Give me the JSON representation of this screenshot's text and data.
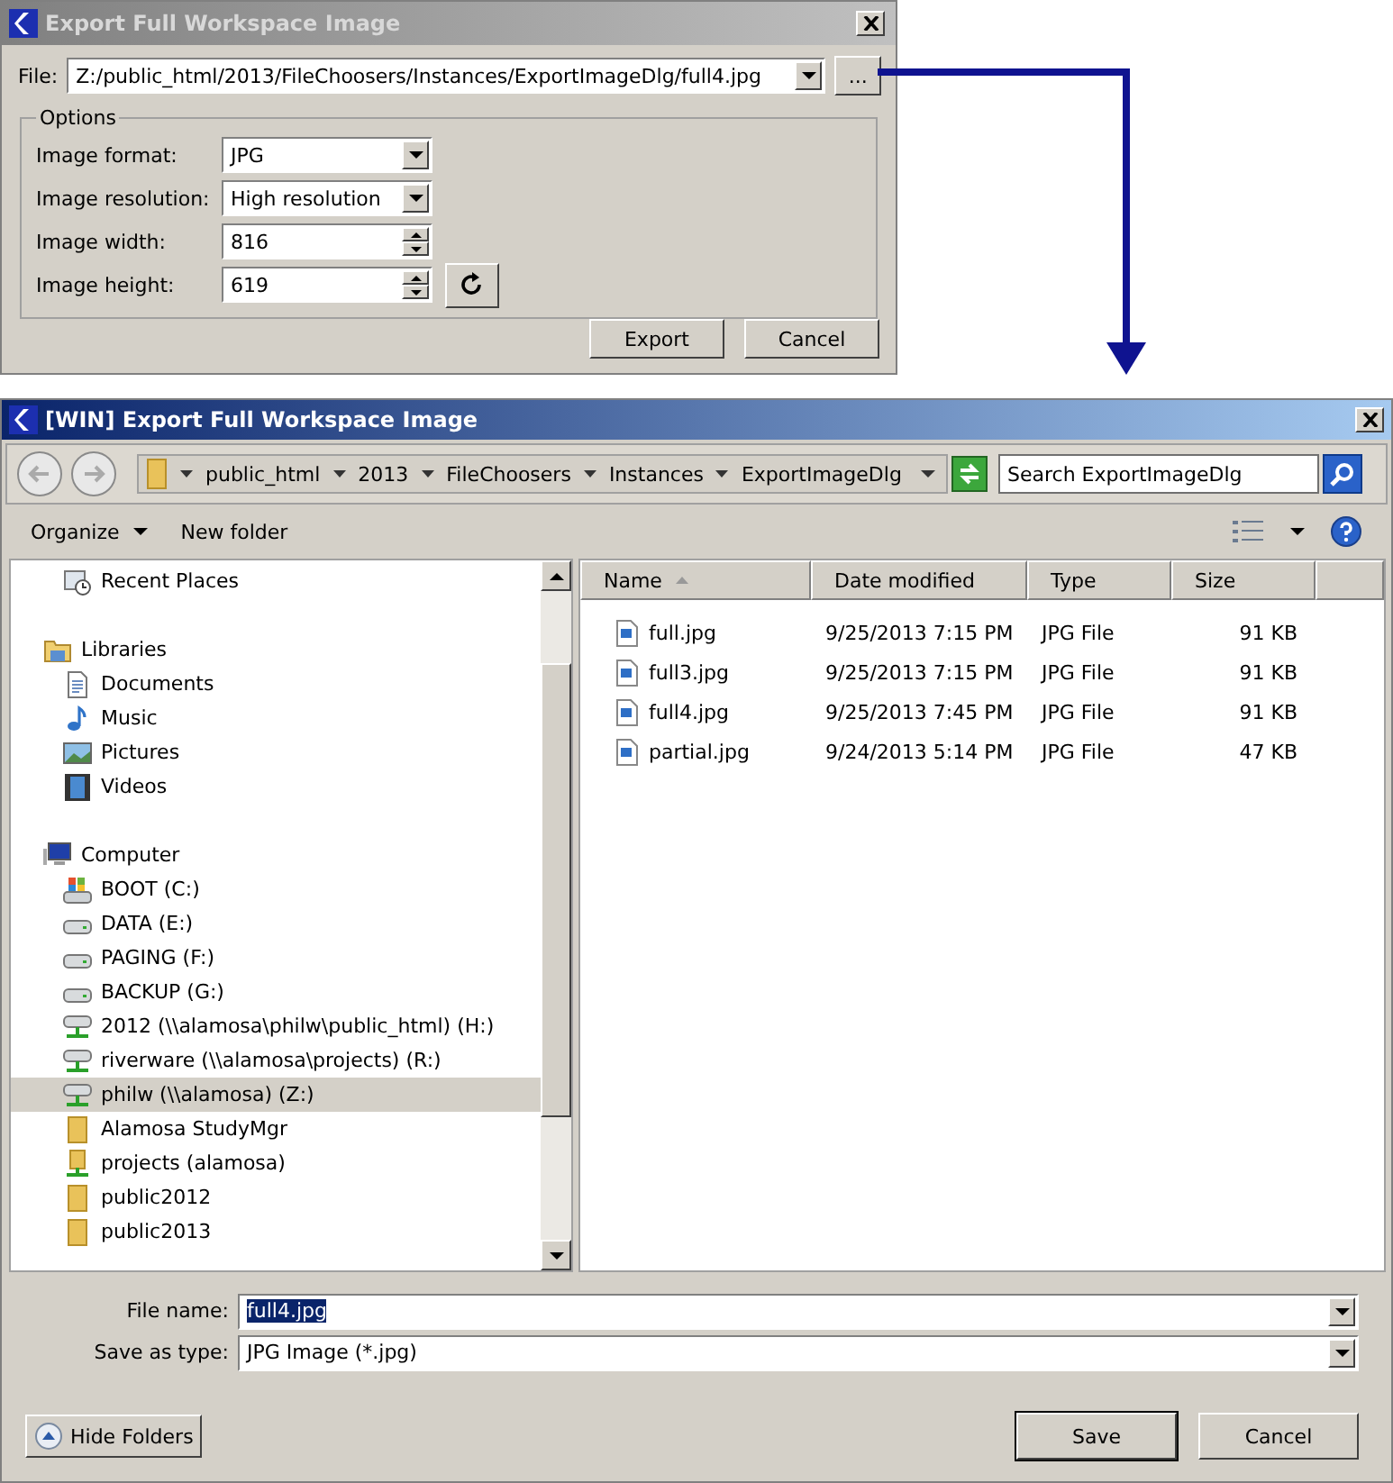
{
  "export_dialog": {
    "title": "Export Full Workspace Image",
    "file_label": "File:",
    "file_value": "Z:/public_html/2013/FileChoosers/Instances/ExportImageDlg/full4.jpg",
    "browse_button": "...",
    "options_title": "Options",
    "options": [
      {
        "kind": "dropdown",
        "label": "Image format:",
        "value": "JPG"
      },
      {
        "kind": "dropdown",
        "label": "Image resolution:",
        "value": "High resolution"
      },
      {
        "kind": "spinner",
        "label": "Image width:",
        "value": "816"
      },
      {
        "kind": "spinner",
        "label": "Image height:",
        "value": "619"
      }
    ],
    "buttons": [
      "Export",
      "Cancel"
    ]
  },
  "file_dialog": {
    "title": "[WIN] Export Full Workspace Image",
    "breadcrumb": [
      "public_html",
      "2013",
      "FileChoosers",
      "Instances",
      "ExportImageDlg"
    ],
    "search": {
      "placeholder": "Search ExportImageDlg"
    },
    "toolbar": [
      "Organize",
      "New folder"
    ],
    "tree_top": [
      {
        "label": "Recent Places",
        "kind": "recent",
        "selected": false
      }
    ],
    "tree": [
      {
        "label": "Libraries",
        "kind": "library",
        "selected": false,
        "children": [
          {
            "label": "Documents",
            "kind": "document",
            "selected": false
          },
          {
            "label": "Music",
            "kind": "music",
            "selected": false
          },
          {
            "label": "Pictures",
            "kind": "pictures",
            "selected": false
          },
          {
            "label": "Videos",
            "kind": "videos",
            "selected": false
          }
        ]
      },
      {
        "label": "Computer",
        "kind": "computer",
        "selected": false,
        "children": [
          {
            "label": "BOOT (C:)",
            "kind": "boot",
            "selected": false
          },
          {
            "label": "DATA (E:)",
            "kind": "drive",
            "selected": false
          },
          {
            "label": "PAGING (F:)",
            "kind": "drive",
            "selected": false
          },
          {
            "label": "BACKUP (G:)",
            "kind": "drive",
            "selected": false
          },
          {
            "label": "2012 (\\\\alamosa\\philw\\public_html) (H:)",
            "kind": "netdrive",
            "selected": false
          },
          {
            "label": "riverware (\\\\alamosa\\projects) (R:)",
            "kind": "netdrive",
            "selected": false
          },
          {
            "label": "philw (\\\\alamosa) (Z:)",
            "kind": "netdrive",
            "selected": true
          },
          {
            "label": "Alamosa StudyMgr",
            "kind": "folder",
            "selected": false
          },
          {
            "label": "projects (alamosa)",
            "kind": "netfolder",
            "selected": false
          },
          {
            "label": "public2012",
            "kind": "folder",
            "selected": false
          },
          {
            "label": "public2013",
            "kind": "folder",
            "selected": false
          }
        ]
      }
    ],
    "columns": [
      "Name",
      "Date modified",
      "Type",
      "Size"
    ],
    "files": [
      {
        "name": "full.jpg",
        "date": "9/25/2013 7:15 PM",
        "type": "JPG File",
        "size": "91 KB"
      },
      {
        "name": "full3.jpg",
        "date": "9/25/2013 7:15 PM",
        "type": "JPG File",
        "size": "91 KB"
      },
      {
        "name": "full4.jpg",
        "date": "9/25/2013 7:45 PM",
        "type": "JPG File",
        "size": "91 KB"
      },
      {
        "name": "partial.jpg",
        "date": "9/24/2013 5:14 PM",
        "type": "JPG File",
        "size": "47 KB"
      }
    ],
    "file_name_label": "File name:",
    "file_name": "full4.jpg",
    "type_label": "Save as type:",
    "type_value": "JPG Image (*.jpg)",
    "hide_folders": "Hide Folders",
    "buttons": [
      "Save",
      "Cancel"
    ]
  }
}
